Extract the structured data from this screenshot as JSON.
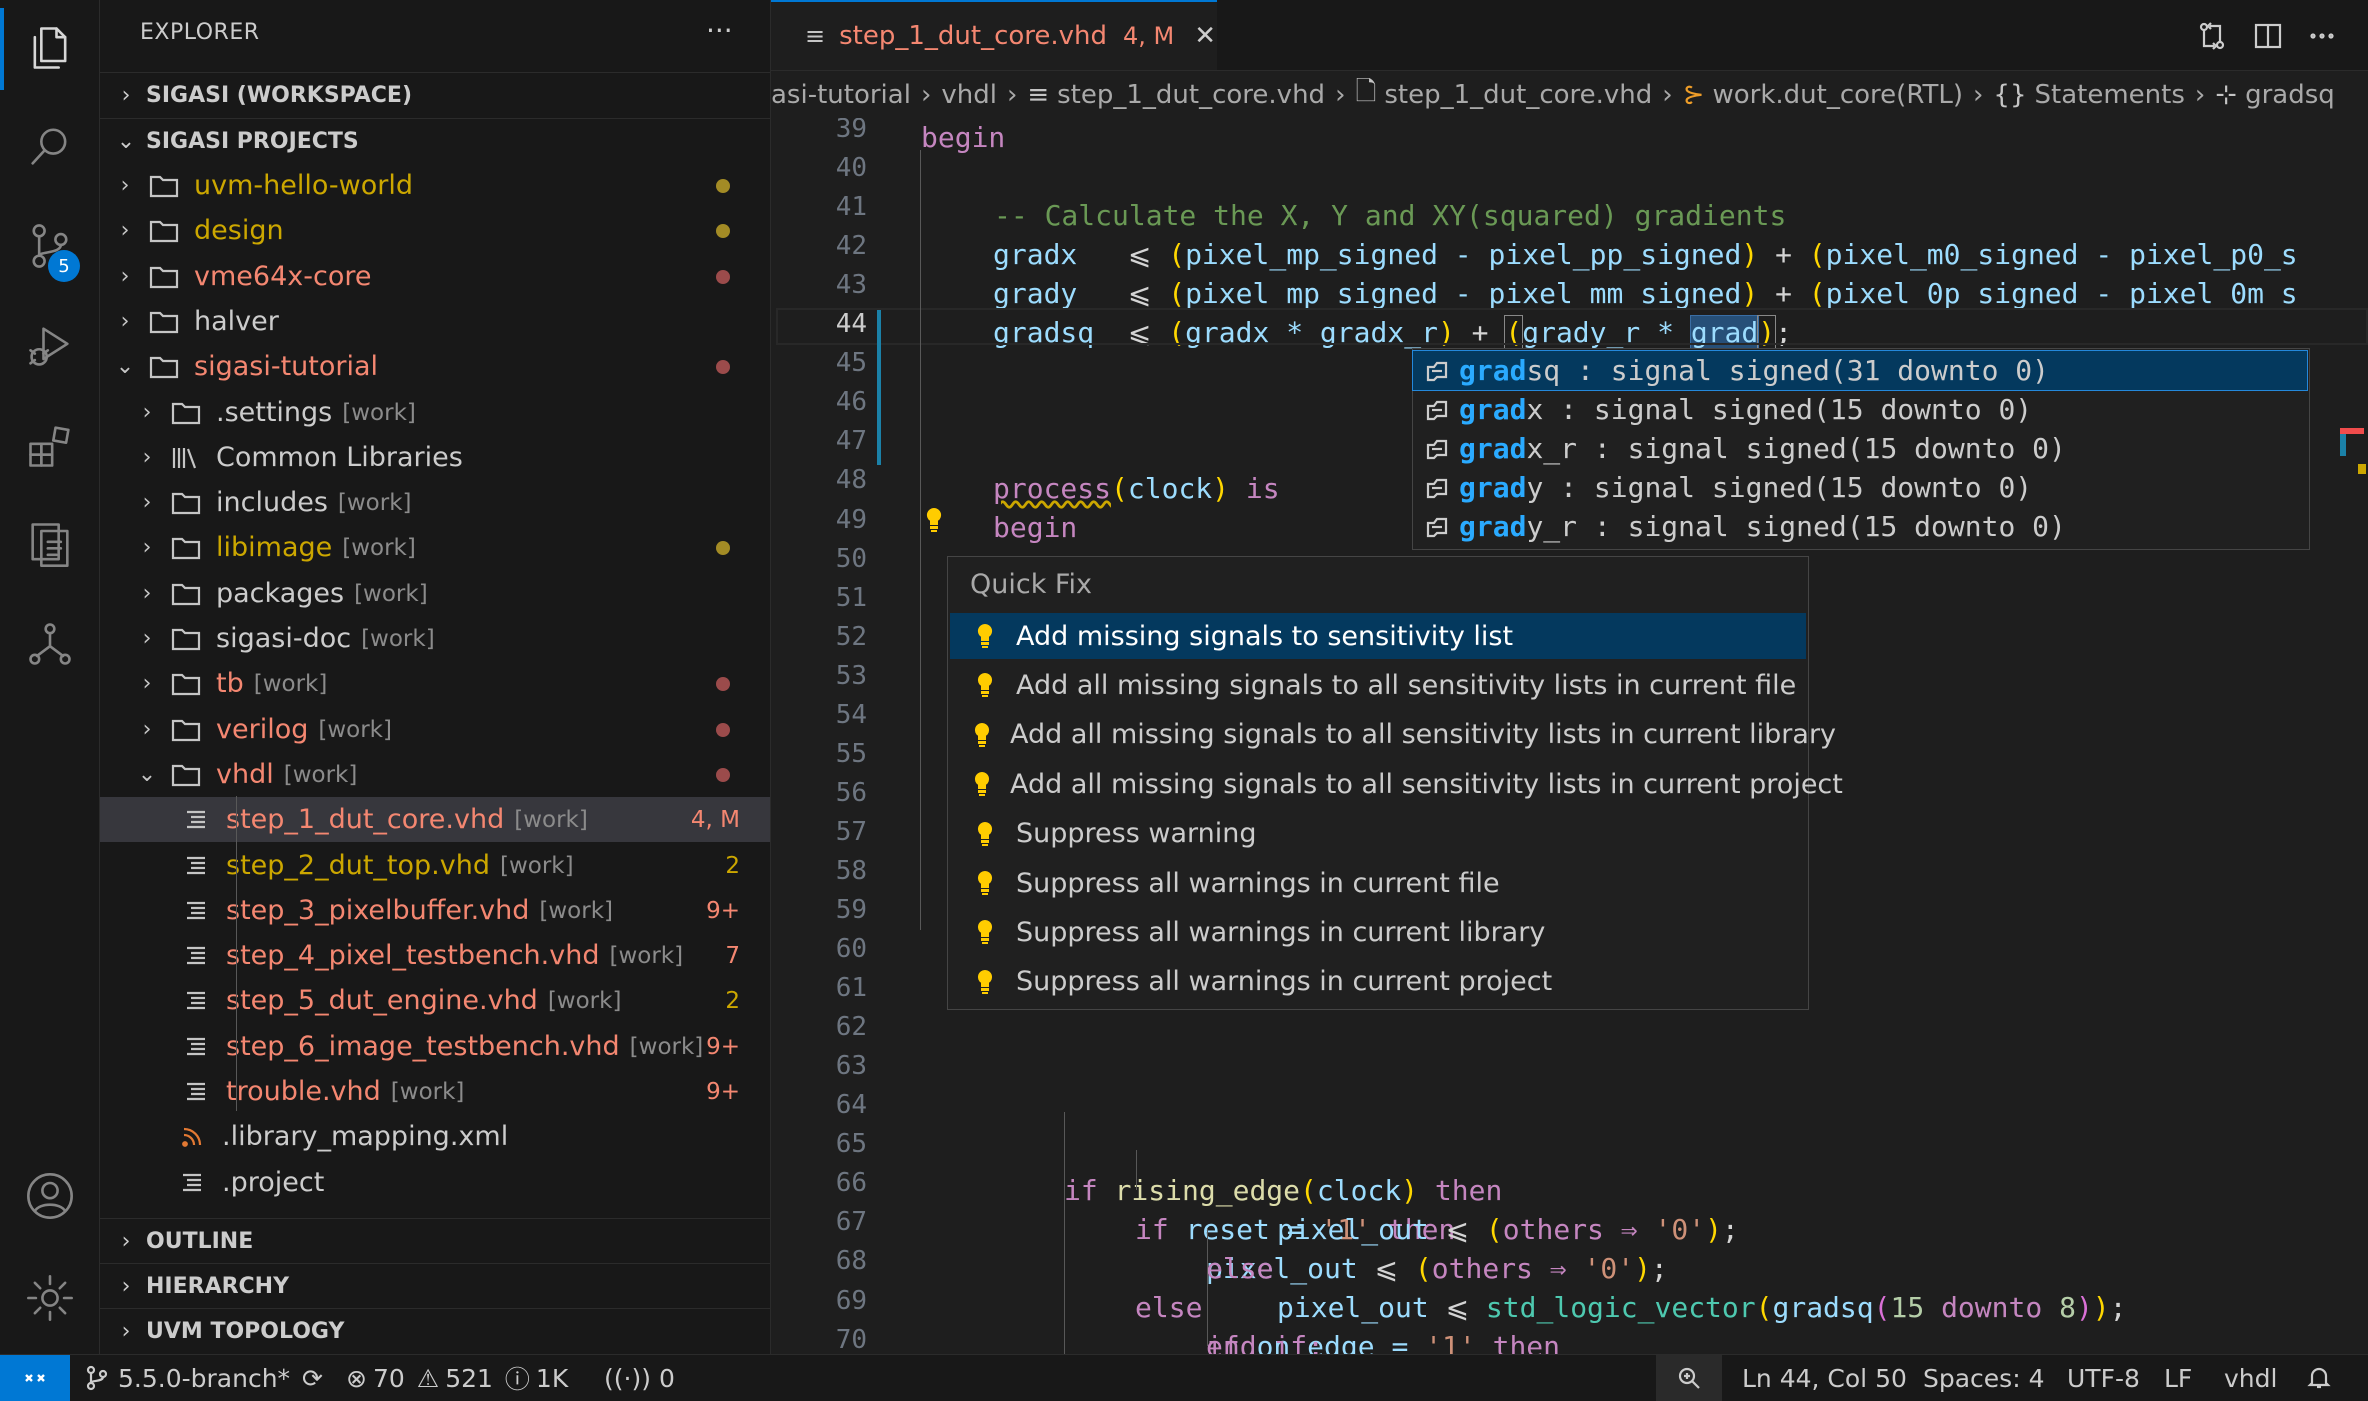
{
  "activity_bar": {
    "icons": [
      "explorer-icon",
      "search-icon",
      "source-control-icon",
      "run-debug-icon",
      "extensions-icon",
      "testing-icon",
      "hierarchy-icon",
      "account-icon",
      "settings-gear-icon"
    ],
    "scm_badge": "5"
  },
  "sidebar": {
    "title": "EXPLORER",
    "more": "···",
    "sections": {
      "workspace": "SIGASI (WORKSPACE)",
      "projects": "SIGASI PROJECTS",
      "outline": "OUTLINE",
      "hierarchy": "HIERARCHY",
      "uvm": "UVM TOPOLOGY"
    },
    "tree": [
      {
        "label": "uvm-hello-world",
        "tag": "",
        "badge": ""
      },
      {
        "label": "design",
        "tag": "",
        "badge": ""
      },
      {
        "label": "vme64x-core",
        "tag": "",
        "badge": ""
      },
      {
        "label": "halver",
        "tag": "",
        "badge": ""
      },
      {
        "label": "sigasi-tutorial",
        "tag": "",
        "badge": ""
      },
      {
        "label": ".settings",
        "tag": "[work]",
        "badge": ""
      },
      {
        "label": "Common Libraries",
        "tag": "",
        "badge": ""
      },
      {
        "label": "includes",
        "tag": "[work]",
        "badge": ""
      },
      {
        "label": "libimage",
        "tag": "[work]",
        "badge": ""
      },
      {
        "label": "packages",
        "tag": "[work]",
        "badge": ""
      },
      {
        "label": "sigasi-doc",
        "tag": "[work]",
        "badge": ""
      },
      {
        "label": "tb",
        "tag": "[work]",
        "badge": ""
      },
      {
        "label": "verilog",
        "tag": "[work]",
        "badge": ""
      },
      {
        "label": "vhdl",
        "tag": "[work]",
        "badge": ""
      },
      {
        "label": "step_1_dut_core.vhd",
        "tag": "[work]",
        "badge": "4, M"
      },
      {
        "label": "step_2_dut_top.vhd",
        "tag": "[work]",
        "badge": "2"
      },
      {
        "label": "step_3_pixelbuffer.vhd",
        "tag": "[work]",
        "badge": "9+"
      },
      {
        "label": "step_4_pixel_testbench.vhd",
        "tag": "[work]",
        "badge": "7"
      },
      {
        "label": "step_5_dut_engine.vhd",
        "tag": "[work]",
        "badge": "2"
      },
      {
        "label": "step_6_image_testbench.vhd",
        "tag": "[work]",
        "badge": "9+"
      },
      {
        "label": "trouble.vhd",
        "tag": "[work]",
        "badge": "9+"
      },
      {
        "label": ".library_mapping.xml",
        "tag": "",
        "badge": ""
      },
      {
        "label": ".project",
        "tag": "",
        "badge": ""
      }
    ]
  },
  "tab": {
    "name": "step_1_dut_core.vhd",
    "status": "4, M",
    "close": "✕"
  },
  "breadcrumb": [
    "asi-tutorial",
    "vhdl",
    "step_1_dut_core.vhd",
    "step_1_dut_core.vhd",
    "work.dut_core(RTL)",
    "Statements",
    "gradsq"
  ],
  "code": {
    "line_numbers": [
      "39",
      "40",
      "41",
      "42",
      "43",
      "44",
      "45",
      "46",
      "47",
      "48",
      "49",
      "50",
      "51",
      "52",
      "53",
      "54",
      "55",
      "56",
      "57",
      "58",
      "59",
      "60",
      "61",
      "62",
      "63",
      "64",
      "65",
      "66",
      "67",
      "68",
      "69",
      "70"
    ],
    "l39": "begin",
    "l41": "-- Calculate the X, Y and XY(squared) gradients",
    "l42": [
      "gradx  ",
      "⩽",
      "(",
      "pixel_mp_signed - pixel_pp_signed",
      ")",
      " + ",
      "(",
      "pixel_m0_signed - pixel_p0_s"
    ],
    "l43": [
      "grady  ",
      "⩽",
      "(",
      "pixel_mp_signed - pixel_mm_signed",
      ")",
      " + ",
      "(",
      "pixel_0p_signed - pixel_0m_s"
    ],
    "l44": [
      "gradsq ",
      "⩽",
      "(",
      "gradx * gradx_r",
      ")",
      " + ",
      "(",
      "grady_r * ",
      "grad",
      ")",
      ";"
    ],
    "l49": [
      "process",
      "(",
      "clock",
      ")",
      " is"
    ],
    "l50": "begin",
    "l62": [
      "if ",
      "rising_edge",
      "(",
      "clock",
      ")",
      " then"
    ],
    "l63": [
      "if ",
      "reset = ",
      "'1'",
      " then"
    ],
    "l64": [
      "pixel_out ",
      "⩽",
      " ",
      "(",
      "others ⇒ ",
      "'0'",
      ")",
      ";"
    ],
    "l65": "else",
    "l66": [
      "if ",
      "on_edge = ",
      "'1'",
      " then"
    ],
    "l67": [
      "pixel_out ",
      "⩽",
      " ",
      "(",
      "others ⇒ ",
      "'0'",
      ")",
      ";"
    ],
    "l68": "else",
    "l69": [
      "pixel_out ",
      "⩽",
      " ",
      "std_logic_vector",
      "(",
      "gradsq",
      "(",
      "15",
      " downto ",
      "8",
      ")",
      ")",
      ";"
    ],
    "l70": "end if;"
  },
  "suggest": [
    {
      "match": "grad",
      "rest": "sq : signal signed(31 downto 0)"
    },
    {
      "match": "grad",
      "rest": "x : signal signed(15 downto 0)"
    },
    {
      "match": "grad",
      "rest": "x_r : signal signed(15 downto 0)"
    },
    {
      "match": "grad",
      "rest": "y : signal signed(15 downto 0)"
    },
    {
      "match": "grad",
      "rest": "y_r : signal signed(15 downto 0)"
    }
  ],
  "quickfix": {
    "title": "Quick Fix",
    "items": [
      "Add missing signals to sensitivity list",
      "Add all missing signals to all sensitivity lists in current file",
      "Add all missing signals to all sensitivity lists in current library",
      "Add all missing signals to all sensitivity lists in current project",
      "Suppress warning",
      "Suppress all warnings in current file",
      "Suppress all warnings in current library",
      "Suppress all warnings in current project"
    ]
  },
  "statusbar": {
    "branch": "5.5.0-branch*",
    "errors": "70",
    "warnings": "521",
    "infos": "1K",
    "ports": "0",
    "position": "Ln 44, Col 50",
    "spaces": "Spaces: 4",
    "encoding": "UTF-8",
    "eol": "LF",
    "language": "vhdl"
  },
  "colors": {
    "accent": "#0078d4",
    "git_modified": "#cca700",
    "git_error": "#f14c4c"
  }
}
